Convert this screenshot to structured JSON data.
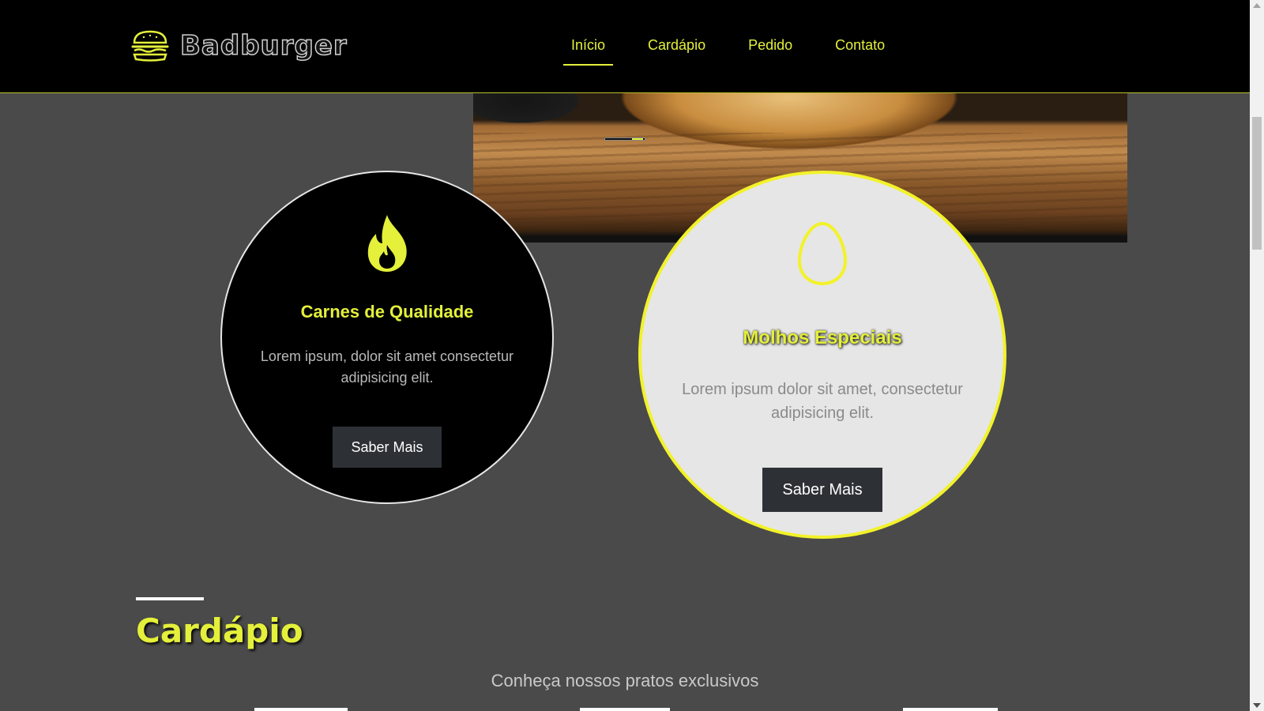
{
  "header": {
    "brand": "Badburger",
    "nav": [
      {
        "label": "Início",
        "active": true
      },
      {
        "label": "Cardápio",
        "active": false
      },
      {
        "label": "Pedido",
        "active": false
      },
      {
        "label": "Contato",
        "active": false
      }
    ]
  },
  "features": [
    {
      "icon": "fire-icon",
      "title": "Carnes de Qualidade",
      "text": "Lorem ipsum, dolor sit amet consectetur adipisicing elit.",
      "button": "Saber Mais"
    },
    {
      "icon": "egg-icon",
      "title": "Molhos Especiais",
      "text": "Lorem ipsum dolor sit amet, consectetur adipisicing elit.",
      "button": "Saber Mais"
    }
  ],
  "menu_section": {
    "title": "Cardápio",
    "subtitle": "Conheça nossos pratos exclusivos"
  },
  "colors": {
    "accent": "#e4f03a",
    "background": "#4a4a4a",
    "header": "#000000",
    "button": "#2d3136"
  }
}
